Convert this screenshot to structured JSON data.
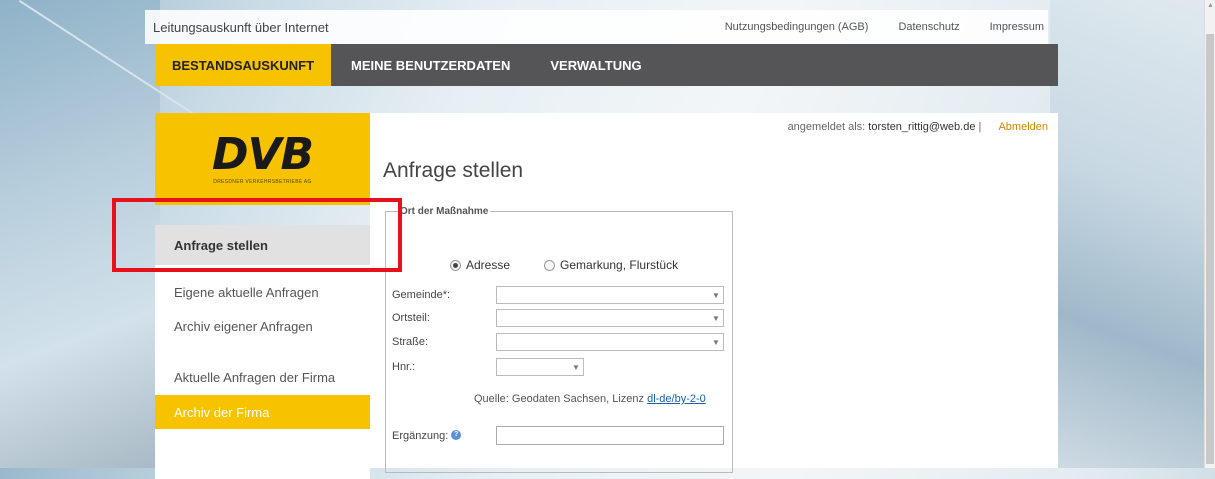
{
  "header": {
    "site_title": "Leitungsauskunft über Internet",
    "links": [
      "Nutzungsbedingungen (AGB)",
      "Datenschutz",
      "Impressum"
    ]
  },
  "nav": {
    "items": [
      "BESTANDSAUSKUNFT",
      "MEINE BENUTZERDATEN",
      "VERWALTUNG"
    ],
    "active_index": 0
  },
  "logo": {
    "text": "DVB",
    "subtitle": "DRESDNER VERKEHRSBETRIEBE AG"
  },
  "sidebar": {
    "active": "Anfrage stellen",
    "items": [
      "Eigene aktuelle Anfragen",
      "Archiv eigener Anfragen",
      "Aktuelle Anfragen der Firma",
      "Archiv der Firma"
    ]
  },
  "session": {
    "label": "angemeldet als:",
    "user": "torsten_rittig@web.de",
    "separator": "|",
    "logout": "Abmelden"
  },
  "main": {
    "title": "Anfrage stellen",
    "fieldset_legend": "Ort der Maßnahme",
    "radio_options": [
      {
        "label": "Adresse",
        "checked": true
      },
      {
        "label": "Gemarkung, Flurstück",
        "checked": false
      }
    ],
    "fields": [
      {
        "label": "Gemeinde*:",
        "value": ""
      },
      {
        "label": "Ortsteil:",
        "value": ""
      },
      {
        "label": "Straße:",
        "value": ""
      },
      {
        "label": "Hnr.:",
        "value": ""
      }
    ],
    "source_text": "Quelle: Geodaten Sachsen, Lizenz",
    "source_link": "dl-de/by-2-0",
    "supplement_label": "Ergänzung:",
    "supplement_value": "",
    "help_icon_glyph": "?"
  },
  "colors": {
    "accent": "#f7c200",
    "nav_bg": "#555557",
    "highlight": "#e8101a"
  }
}
